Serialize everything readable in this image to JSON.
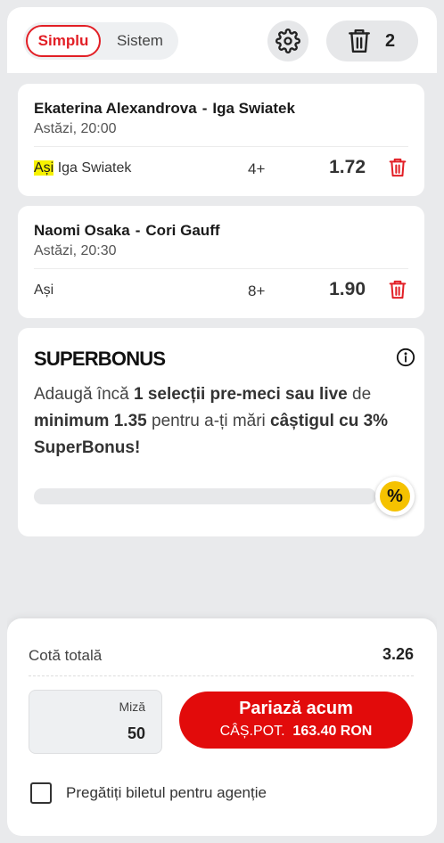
{
  "header": {
    "mode_tabs": [
      {
        "label": "Simplu",
        "active": true
      },
      {
        "label": "Sistem",
        "active": false
      }
    ],
    "settings_icon": "gear-icon",
    "trash_icon": "trash-icon",
    "selection_count": "2"
  },
  "matches": [
    {
      "home": "Ekaterina Alexandrova",
      "separator": "-",
      "away": "Iga Swiatek",
      "time": "Astăzi, 20:00",
      "market": "Ași",
      "market_highlighted": true,
      "selection": "Iga Swiatek",
      "line": "4+",
      "odd": "1.72"
    },
    {
      "home": "Naomi Osaka",
      "separator": "-",
      "away": "Cori Gauff",
      "time": "Astăzi, 20:30",
      "market": "Ași",
      "market_highlighted": false,
      "selection": "",
      "line": "8+",
      "odd": "1.90"
    }
  ],
  "superbonus": {
    "title": "SUPERBONUS",
    "text_1": "Adaugă încă ",
    "text_2": "1 selecții pre-meci sau live",
    "text_3": " de ",
    "text_4": "minimum 1.35",
    "text_5": " pentru a-ți mări ",
    "text_6": "câștigul cu 3% SuperBonus!",
    "progress": 0,
    "badge_symbol": "%"
  },
  "footer": {
    "total_label": "Cotă totală",
    "total_value": "3.26",
    "stake_label": "Miză",
    "stake_value": "50",
    "bet_label": "Pariază acum",
    "payout_label": "CÂȘ.POT.",
    "payout_value": "163.40 RON",
    "agency_label": "Pregătiți biletul pentru agenție",
    "agency_checked": false
  },
  "colors": {
    "accent": "#e21f26",
    "bet_button": "#e20b0b",
    "highlight": "#f7f200",
    "bonus_coin": "#f5c200"
  }
}
